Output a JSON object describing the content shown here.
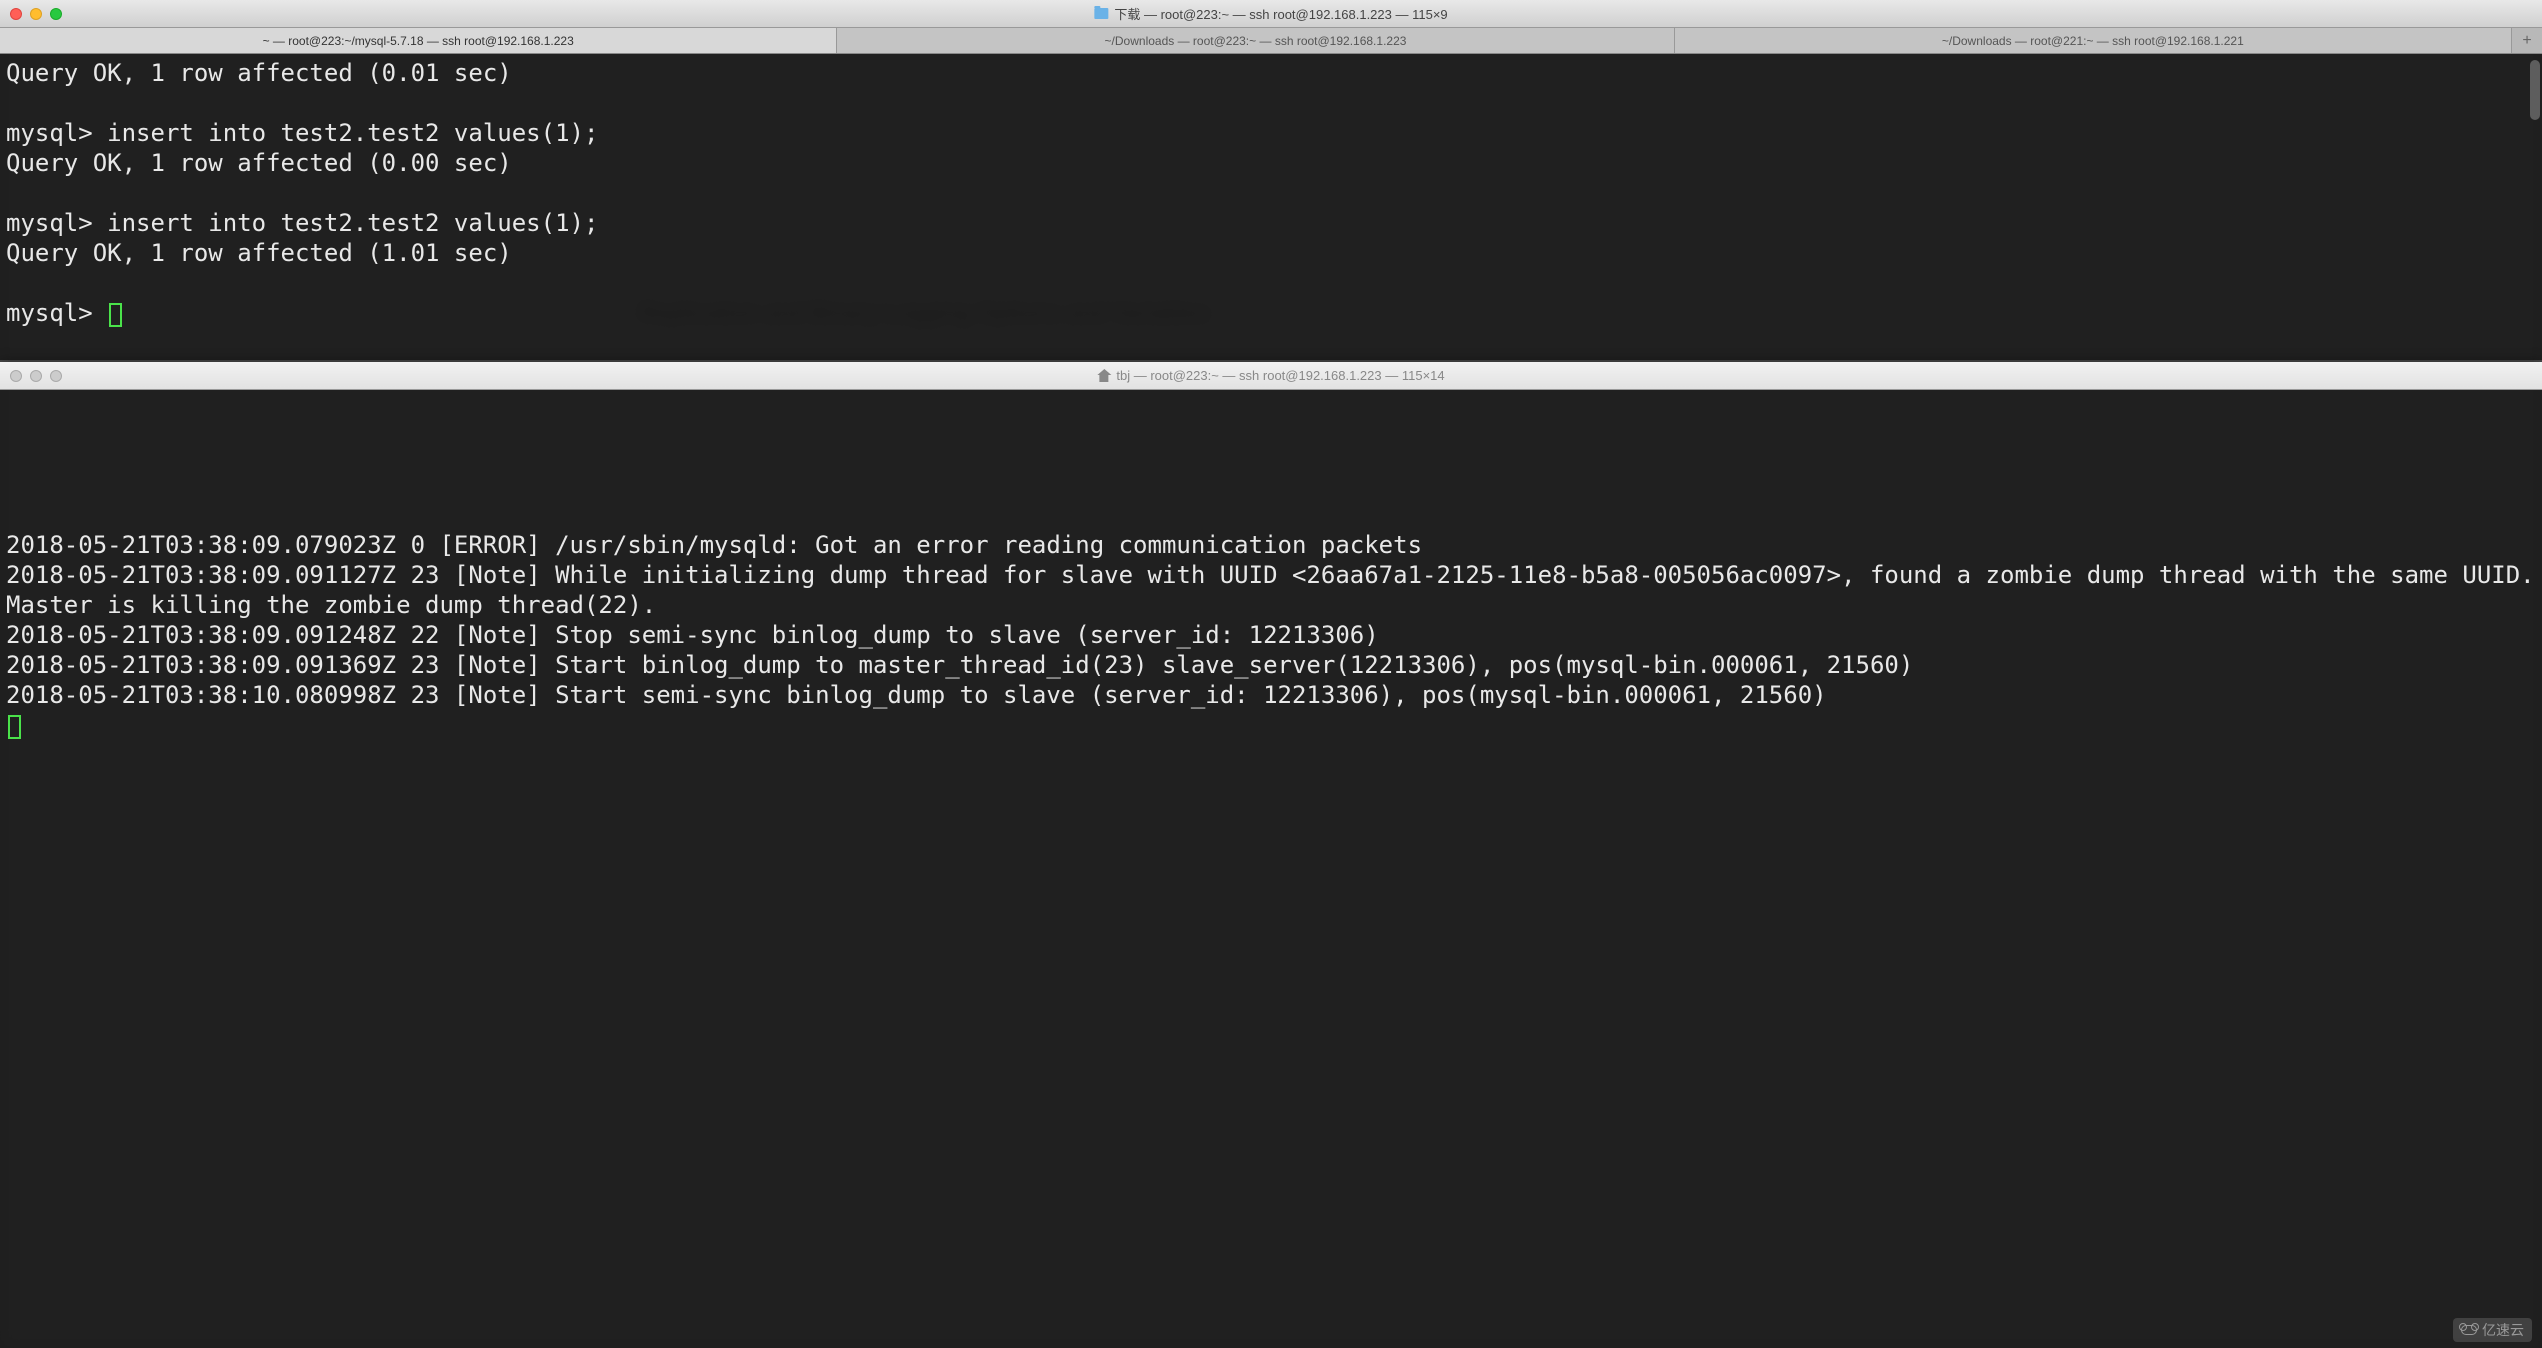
{
  "window_top": {
    "title": "下载 — root@223:~ — ssh root@192.168.1.223 — 115×9",
    "tabs": [
      {
        "label": "~ — root@223:~/mysql-5.7.18 — ssh root@192.168.1.223",
        "active": true
      },
      {
        "label": "~/Downloads — root@223:~ — ssh root@192.168.1.223",
        "active": false
      },
      {
        "label": "~/Downloads — root@221:~ — ssh root@192.168.1.221",
        "active": false
      }
    ],
    "add_tab": "+",
    "lines": [
      "Query OK, 1 row affected (0.01 sec)",
      "",
      "mysql> insert into test2.test2 values(1);",
      "Query OK, 1 row affected (0.00 sec)",
      "",
      "mysql> insert into test2.test2 values(1);",
      "Query OK, 1 row affected (1.01 sec)",
      "",
      "mysql> "
    ]
  },
  "window_bottom": {
    "title": "tbj — root@223:~ — ssh root@192.168.1.223 — 115×14",
    "lines": [
      "2018-05-21T03:38:09.079023Z 0 [ERROR] /usr/sbin/mysqld: Got an error reading communication packets",
      "2018-05-21T03:38:09.091127Z 23 [Note] While initializing dump thread for slave with UUID <26aa67a1-2125-11e8-b5a8-005056ac0097>, found a zombie dump thread with the same UUID. Master is killing the zombie dump thread(22).",
      "2018-05-21T03:38:09.091248Z 22 [Note] Stop semi-sync binlog_dump to slave (server_id: 12213306)",
      "2018-05-21T03:38:09.091369Z 23 [Note] Start binlog_dump to master_thread_id(23) slave_server(12213306), pos(mysql-bin.000061, 21560)",
      "2018-05-21T03:38:10.080998Z 23 [Note] Start semi-sync binlog_dump to slave (server_id: 12213306), pos(mysql-bin.000061, 21560)"
    ]
  },
  "background_hint": "Replication and Binary Logging Options and Variables",
  "watermark": "亿速云"
}
